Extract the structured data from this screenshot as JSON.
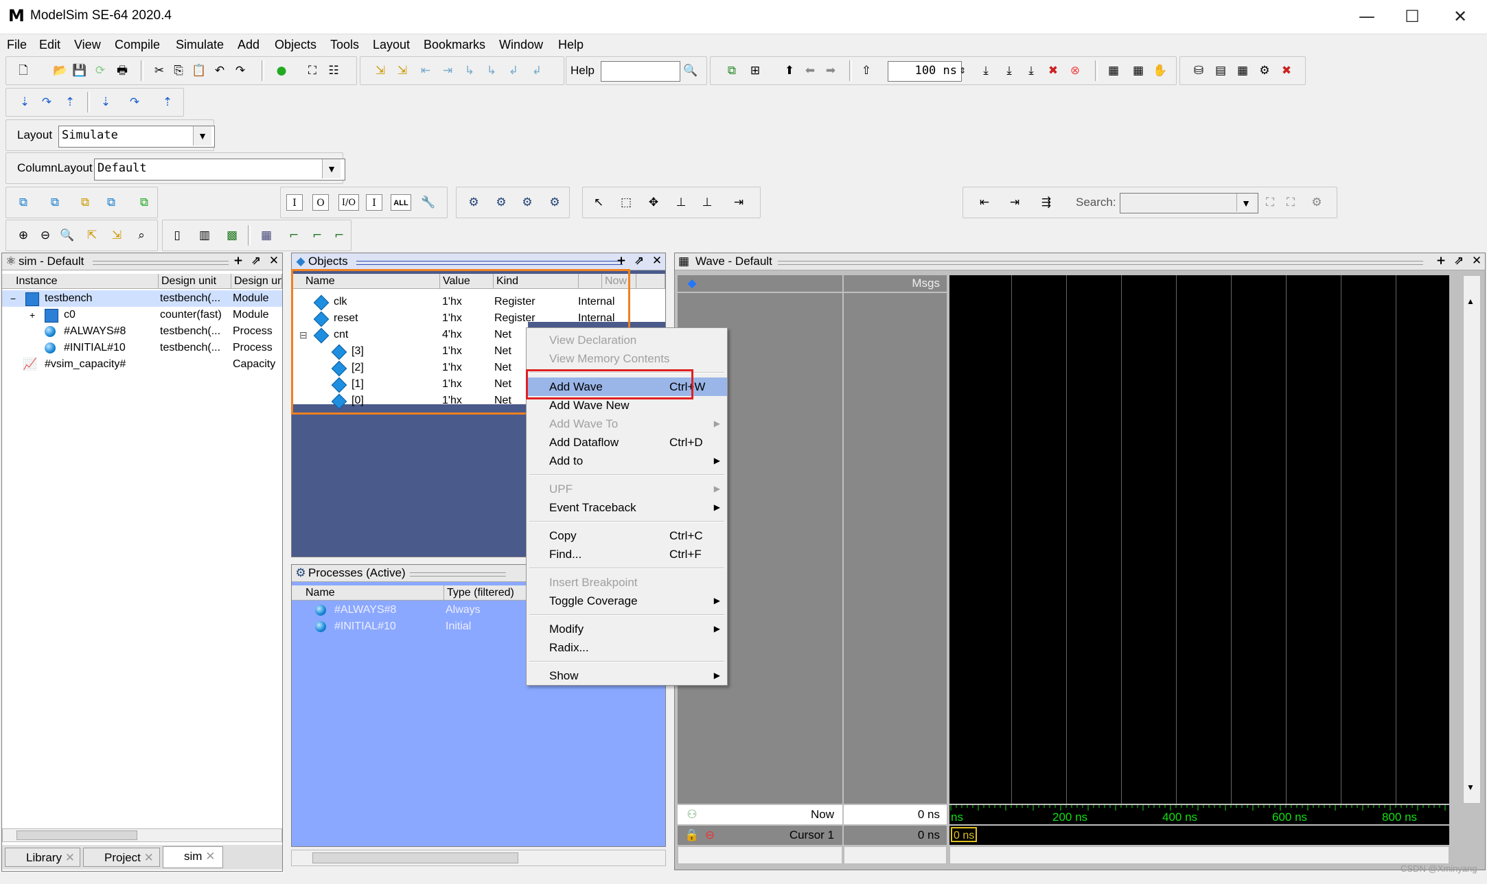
{
  "window": {
    "title": "ModelSim SE-64 2020.4",
    "logo": "M",
    "minimize": "—",
    "maximize": "☐",
    "close": "✕"
  },
  "menubar": [
    "File",
    "Edit",
    "View",
    "Compile",
    "Simulate",
    "Add",
    "Objects",
    "Tools",
    "Layout",
    "Bookmarks",
    "Window",
    "Help"
  ],
  "toolbar": {
    "help_label": "Help",
    "help_value": "",
    "run_length": "100 ns"
  },
  "layout_bar": {
    "label": "Layout",
    "value": "Simulate"
  },
  "column_layout_bar": {
    "label": "ColumnLayout",
    "value": "Default"
  },
  "filter_buttons": [
    "I",
    "O",
    "I/O",
    "I",
    "ALL"
  ],
  "search": {
    "label": "Search:",
    "value": ""
  },
  "sim_pane": {
    "title": "sim - Default",
    "columns": [
      "Instance",
      "Design unit",
      "Design un"
    ],
    "rows": [
      {
        "instance": "testbench",
        "unit": "testbench(...",
        "type": "Module",
        "expand": "−"
      },
      {
        "instance": "c0",
        "unit": "counter(fast)",
        "type": "Module",
        "expand": "+"
      },
      {
        "instance": "#ALWAYS#8",
        "unit": "testbench(...",
        "type": "Process",
        "expand": ""
      },
      {
        "instance": "#INITIAL#10",
        "unit": "testbench(...",
        "type": "Process",
        "expand": ""
      },
      {
        "instance": "#vsim_capacity#",
        "unit": "",
        "type": "Capacity",
        "expand": ""
      }
    ],
    "tabs": [
      "Library",
      "Project",
      "sim"
    ]
  },
  "objects_pane": {
    "title": "Objects",
    "columns": [
      "Name",
      "Value",
      "Kind",
      "",
      "Now"
    ],
    "rows": [
      {
        "name": "clk",
        "value": "1'hx",
        "kind": "Register",
        "mode": "Internal"
      },
      {
        "name": "reset",
        "value": "1'hx",
        "kind": "Register",
        "mode": "Internal"
      },
      {
        "name": "cnt",
        "value": "4'hx",
        "kind": "Net",
        "mode": ""
      },
      {
        "name": "[3]",
        "value": "1'hx",
        "kind": "Net",
        "mode": ""
      },
      {
        "name": "[2]",
        "value": "1'hx",
        "kind": "Net",
        "mode": ""
      },
      {
        "name": "[1]",
        "value": "1'hx",
        "kind": "Net",
        "mode": ""
      },
      {
        "name": "[0]",
        "value": "1'hx",
        "kind": "Net",
        "mode": ""
      }
    ]
  },
  "processes_pane": {
    "title": "Processes (Active)",
    "columns": [
      "Name",
      "Type (filtered)"
    ],
    "rows": [
      {
        "name": "#ALWAYS#8",
        "type": "Always"
      },
      {
        "name": "#INITIAL#10",
        "type": "Initial"
      }
    ]
  },
  "context_menu": [
    {
      "label": "View Declaration",
      "key": "",
      "sub": false,
      "disabled": true
    },
    {
      "label": "View Memory Contents",
      "key": "",
      "sub": false,
      "disabled": true
    },
    {
      "sep": true
    },
    {
      "label": "Add Wave",
      "key": "Ctrl+W",
      "sub": false,
      "disabled": false,
      "highlight": true
    },
    {
      "label": "Add Wave New",
      "key": "",
      "sub": false,
      "disabled": false
    },
    {
      "label": "Add Wave To",
      "key": "",
      "sub": true,
      "disabled": true
    },
    {
      "label": "Add Dataflow",
      "key": "Ctrl+D",
      "sub": false,
      "disabled": false
    },
    {
      "label": "Add to",
      "key": "",
      "sub": true,
      "disabled": false
    },
    {
      "sep": true
    },
    {
      "label": "UPF",
      "key": "",
      "sub": true,
      "disabled": true
    },
    {
      "label": "Event Traceback",
      "key": "",
      "sub": true,
      "disabled": false
    },
    {
      "sep": true
    },
    {
      "label": "Copy",
      "key": "Ctrl+C",
      "sub": false,
      "disabled": false
    },
    {
      "label": "Find...",
      "key": "Ctrl+F",
      "sub": false,
      "disabled": false
    },
    {
      "sep": true
    },
    {
      "label": "Insert Breakpoint",
      "key": "",
      "sub": false,
      "disabled": true
    },
    {
      "label": "Toggle Coverage",
      "key": "",
      "sub": true,
      "disabled": false
    },
    {
      "sep": true
    },
    {
      "label": "Modify",
      "key": "",
      "sub": true,
      "disabled": false
    },
    {
      "label": "Radix...",
      "key": "",
      "sub": false,
      "disabled": false
    },
    {
      "sep": true
    },
    {
      "label": "Show",
      "key": "",
      "sub": true,
      "disabled": false
    }
  ],
  "wave_pane": {
    "title": "Wave - Default",
    "msgs_label": "Msgs",
    "now_label": "Now",
    "now_value": "0 ns",
    "cursor_label": "Cursor 1",
    "cursor_value": "0 ns",
    "cursor_marker": "0 ns",
    "timeline_start": "ns",
    "timeline_labels": [
      "200 ns",
      "400 ns",
      "600 ns",
      "800 ns"
    ]
  },
  "watermark": "CSDN @Xminyang",
  "colors": {
    "highlight_box": "#e02020",
    "orange_box": "#f08020",
    "selection": "#8aa8ff",
    "dark_pane": "#4a5a8a",
    "wave_bg": "#000000",
    "wave_text": "#10e010"
  }
}
